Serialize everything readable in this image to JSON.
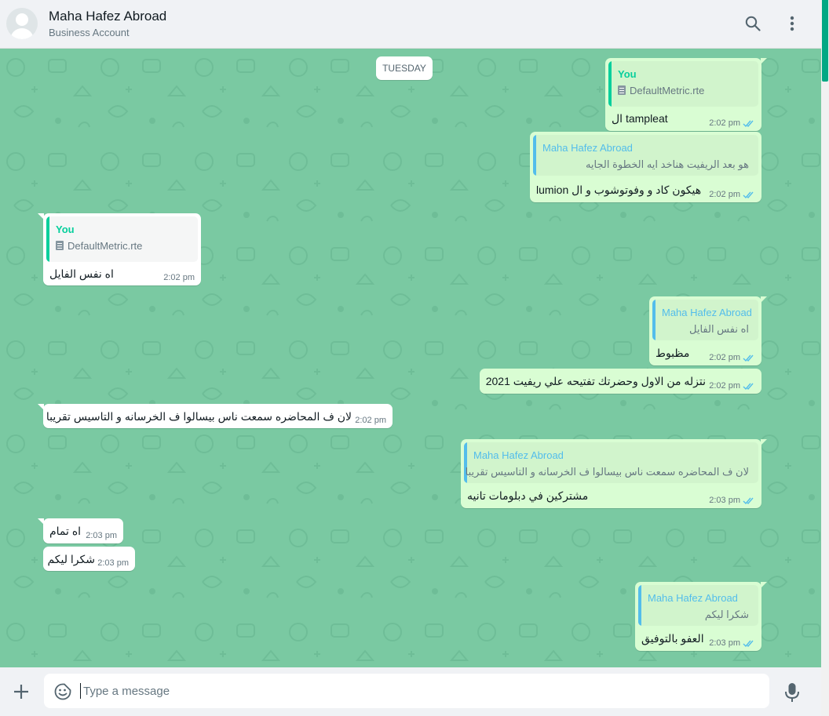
{
  "header": {
    "name": "Maha Hafez Abroad",
    "subtitle": "Business Account"
  },
  "chat": {
    "date_label": "TUESDAY",
    "messages": [
      {
        "direction": "out",
        "quote_author": "You",
        "quote_file": "DefaultMetric.rte",
        "text": "ال tampleat",
        "time": "2:02 pm",
        "read": true
      },
      {
        "direction": "out",
        "quote_author": "Maha Hafez Abroad",
        "quote_text": "هو بعد الريفيت هناخد ايه الخطوة الجايه",
        "text": "هيكون كاد و وفوتوشوب و ال lumion",
        "time": "2:02 pm",
        "read": true
      },
      {
        "direction": "in",
        "quote_author": "You",
        "quote_file": "DefaultMetric.rte",
        "text": "اه نفس الفايل",
        "time": "2:02 pm"
      },
      {
        "direction": "out",
        "quote_author": "Maha Hafez Abroad",
        "quote_text": "اه نفس الفايل",
        "text": "مظبوط",
        "time": "2:02 pm",
        "read": true
      },
      {
        "direction": "out",
        "text": "نتزله من الاول وحضرتك تفتيحه علي ريفيت 2021",
        "time": "2:02 pm",
        "read": true
      },
      {
        "direction": "in",
        "text": "لان ف المحاضره سمعت ناس بيسالوا ف الخرسانه و التاسيس تقريبا",
        "time": "2:02 pm"
      },
      {
        "direction": "out",
        "quote_author": "Maha Hafez Abroad",
        "quote_text": "لان ف المحاضره سمعت ناس بيسالوا ف الخرسانه و التاسيس تقريبا",
        "text": "مشتركين في دبلومات تانيه",
        "time": "2:03 pm",
        "read": true
      },
      {
        "direction": "in",
        "text": "اه تمام",
        "time": "2:03 pm"
      },
      {
        "direction": "in",
        "text": "شكرا ليكم",
        "time": "2:03 pm"
      },
      {
        "direction": "out",
        "quote_author": "Maha Hafez Abroad",
        "quote_text": "شكرا ليكم",
        "text": "العفو بالتوفيق",
        "time": "2:03 pm",
        "read": true
      }
    ]
  },
  "composer": {
    "placeholder": "Type a message"
  },
  "icons": {
    "header": [
      "search-icon",
      "more-vertical-icon"
    ],
    "composer": [
      "plus-icon",
      "emoji-icon",
      "mic-icon"
    ],
    "status": "double-check-icon"
  },
  "colors": {
    "chat_bg": "#7ac9a2",
    "outgoing_bubble": "#d9fdd3",
    "incoming_bubble": "#ffffff",
    "read_ticks": "#53bdeb",
    "quote_you": "#06cf9c",
    "quote_contact": "#53bdeb",
    "scroll_accent": "#00a884"
  }
}
